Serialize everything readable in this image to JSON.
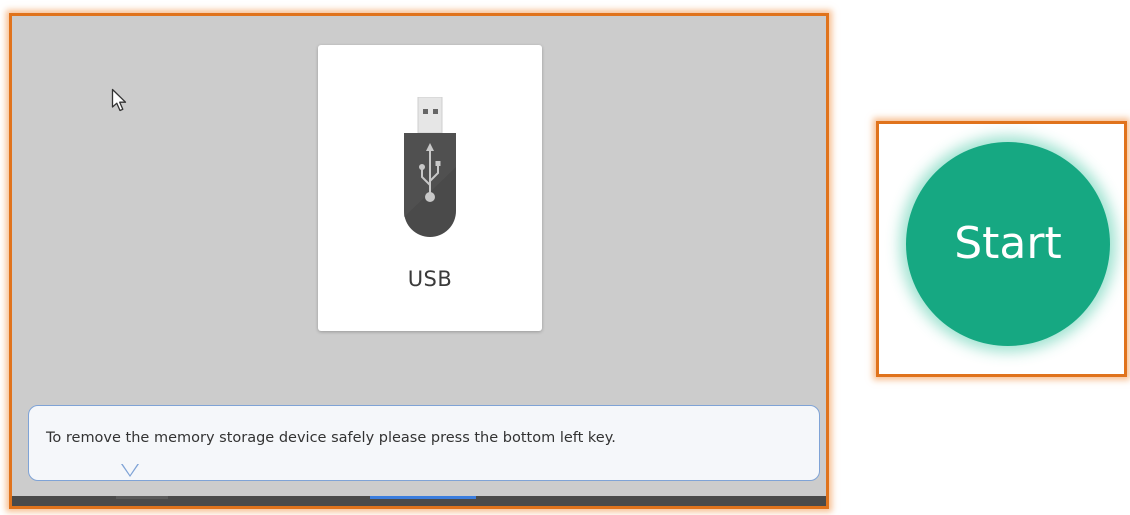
{
  "screen": {
    "usb_card": {
      "label": "USB",
      "icon": "usb-flash-drive-icon"
    },
    "cursor": {
      "icon": "mouse-pointer-icon"
    },
    "tooltip": {
      "text": "To remove the memory storage device safely please press the bottom left key."
    }
  },
  "start_panel": {
    "button_label": "Start"
  },
  "colors": {
    "highlight_border": "#e0731c",
    "screen_background": "#cccccc",
    "start_button": "#16a882",
    "tooltip_border": "#7fa3d6",
    "bottom_bar_active": "#3b7ddd"
  }
}
